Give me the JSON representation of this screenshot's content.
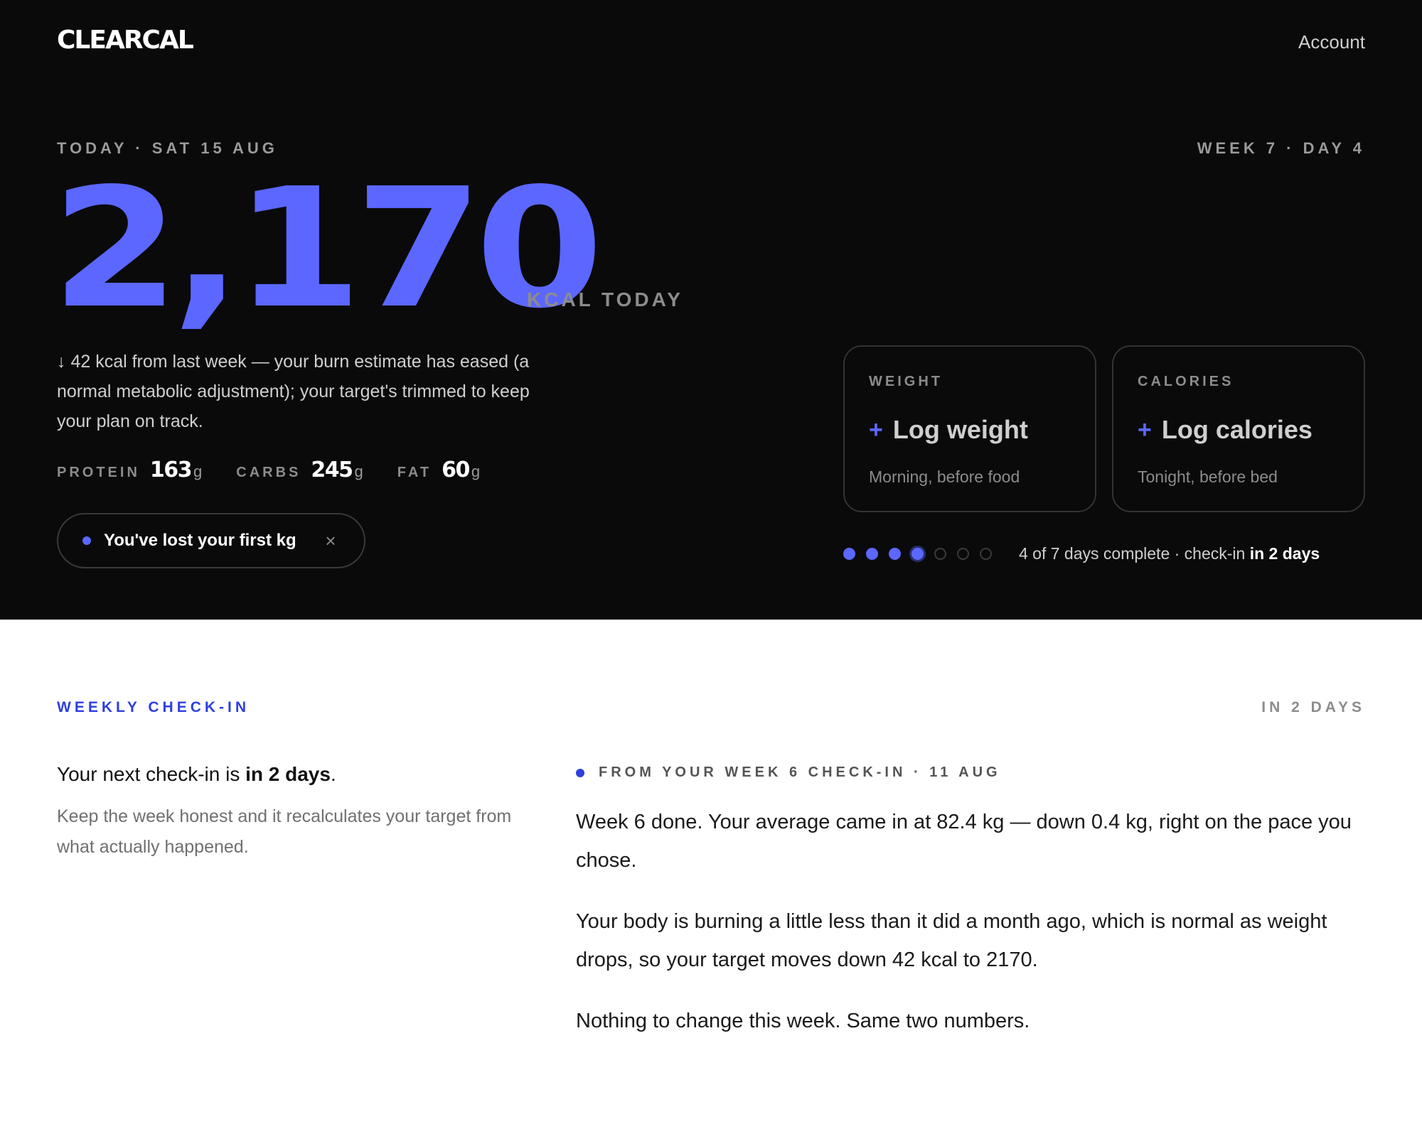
{
  "header": {
    "logo": "CLEARCAL",
    "account_label": "Account"
  },
  "today": {
    "date_label": "TODAY · SAT 15 AUG",
    "week_label": "WEEK 7 · DAY 4",
    "kcal_value": "2,170",
    "kcal_label": "KCAL TODAY",
    "note": "↓ 42 kcal from last week — your burn estimate has eased (a normal metabolic adjustment); your target's trimmed to keep your plan on track."
  },
  "macros": [
    {
      "label": "PROTEIN",
      "value": "163",
      "unit": "g"
    },
    {
      "label": "CARBS",
      "value": "245",
      "unit": "g"
    },
    {
      "label": "FAT",
      "value": "60",
      "unit": "g"
    }
  ],
  "milestone": {
    "text": "You've lost your first kg",
    "close_glyph": "×"
  },
  "cards": {
    "weight": {
      "eyebrow": "WEIGHT",
      "plus": "+",
      "title": "Log weight",
      "sub": "Morning, before food"
    },
    "calories": {
      "eyebrow": "CALORIES",
      "plus": "+",
      "title": "Log calories",
      "sub": "Tonight, before bed"
    }
  },
  "progress": {
    "days_complete": 4,
    "days_total": 7,
    "text_prefix": "4 of 7 days complete · check-in ",
    "text_bold": "in 2 days"
  },
  "checkin": {
    "eyebrow": "WEEKLY CHECK-IN",
    "when": "IN 2 DAYS",
    "next_prefix": "Your next check-in is ",
    "next_bold": "in 2 days",
    "next_suffix": ".",
    "body": "Keep the week honest and it recalculates your target from what actually happened.",
    "from_label": "FROM YOUR WEEK 6 CHECK-IN · 11 AUG",
    "paragraphs": [
      "Week 6 done. Your average came in at 82.4 kg — down 0.4 kg, right on the pace you chose.",
      "Your body is burning a little less than it did a month ago, which is normal as weight drops, so your target moves down 42 kcal to 2170.",
      "Nothing to change this week. Same two numbers."
    ]
  },
  "colors": {
    "accent": "#5b67ff",
    "accent_dark": "#2f3fe0",
    "hero_bg": "#0a0a0a"
  }
}
